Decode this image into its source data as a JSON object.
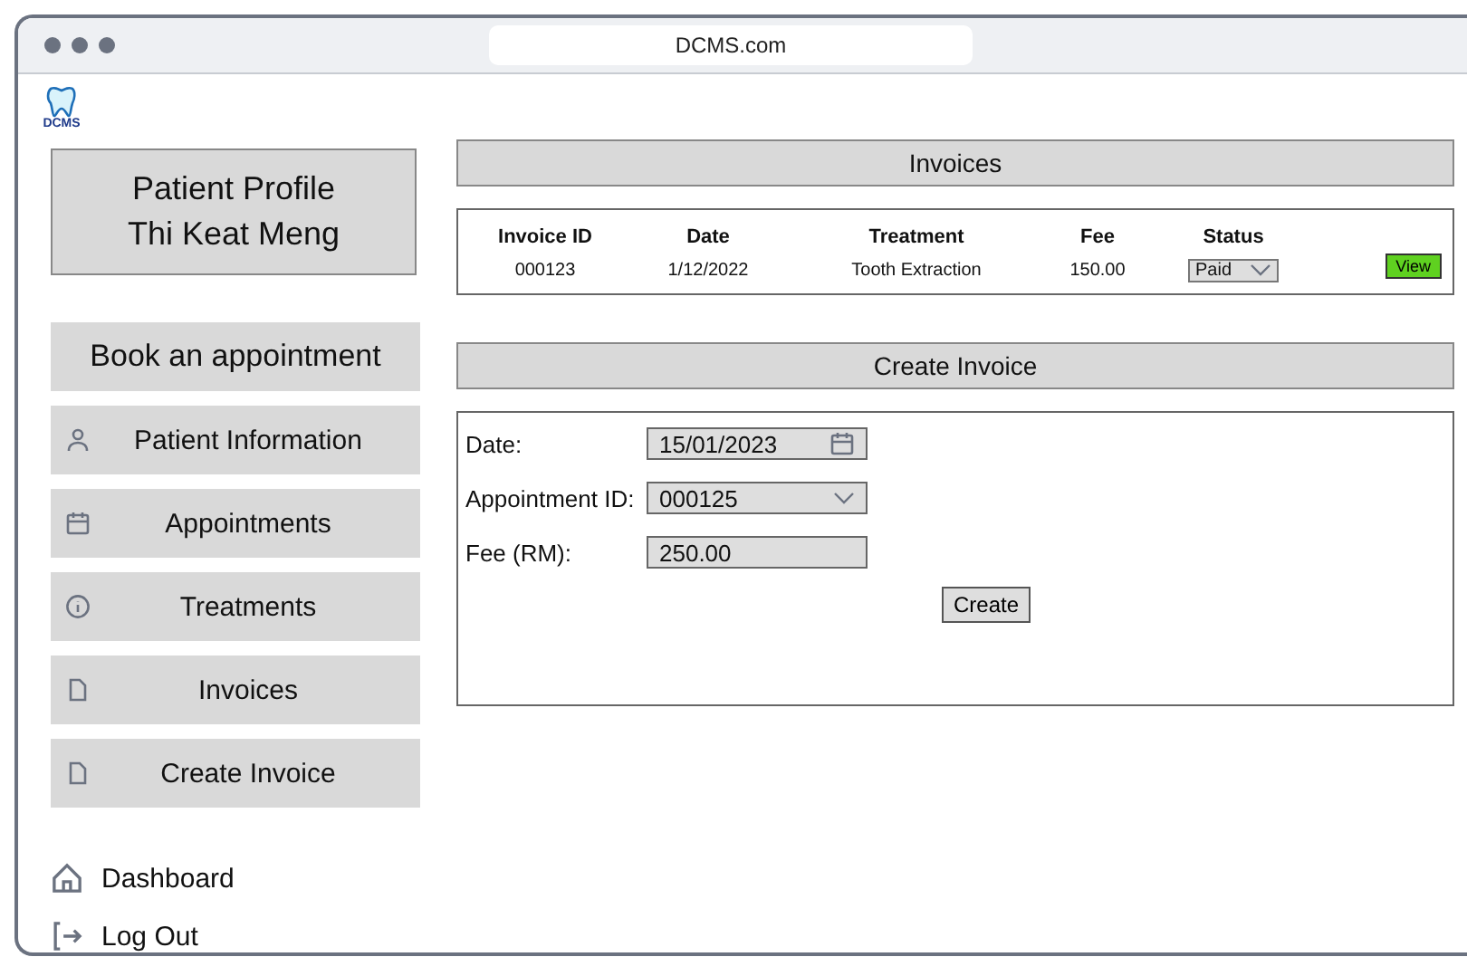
{
  "browser": {
    "url": "DCMS.com"
  },
  "logo": {
    "text": "DCMS"
  },
  "profile": {
    "title": "Patient Profile",
    "name": "Thi Keat Meng"
  },
  "book_button": "Book an appointment",
  "sidebar": {
    "items": [
      {
        "label": "Patient Information",
        "kind": "person"
      },
      {
        "label": "Appointments",
        "kind": "calendar"
      },
      {
        "label": "Treatments",
        "kind": "info"
      },
      {
        "label": "Invoices",
        "kind": "file"
      },
      {
        "label": "Create Invoice",
        "kind": "file"
      }
    ]
  },
  "bottom_links": [
    {
      "label": "Dashboard",
      "kind": "home"
    },
    {
      "label": "Log Out",
      "kind": "logout"
    }
  ],
  "invoices": {
    "title": "Invoices",
    "columns": [
      "Invoice ID",
      "Date",
      "Treatment",
      "Fee",
      "Status"
    ],
    "rows": [
      {
        "cells": [
          "000123",
          "1/12/2022",
          "Tooth Extraction",
          "150.00"
        ],
        "status": "Paid",
        "action": "View"
      }
    ]
  },
  "create_invoice": {
    "title": "Create Invoice",
    "fields": [
      {
        "label": "Date:",
        "value": "15/01/2023",
        "kind": "date"
      },
      {
        "label": "Appointment ID:",
        "value": "000125",
        "kind": "select"
      },
      {
        "label": "Fee (RM):",
        "value": "250.00",
        "kind": "text"
      }
    ],
    "button": "Create"
  }
}
